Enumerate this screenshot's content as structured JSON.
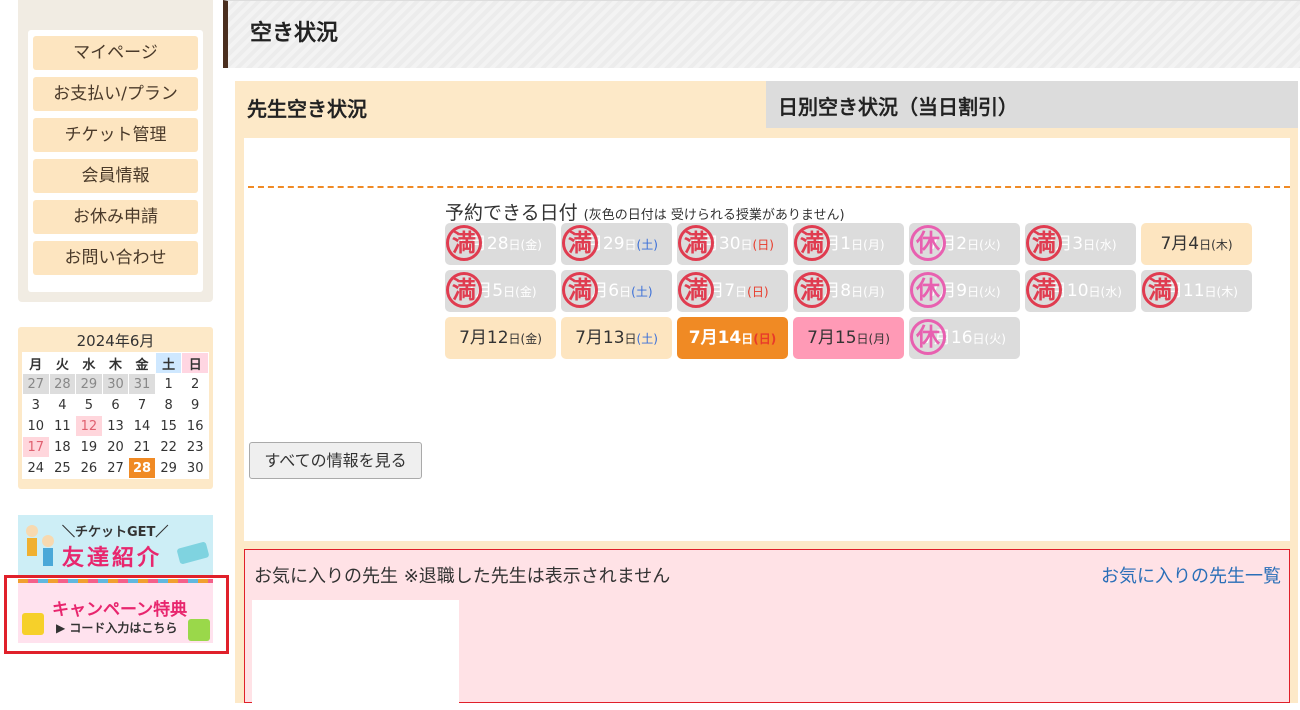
{
  "sidebar": {
    "menu": [
      "マイページ",
      "お支払い/プラン",
      "チケット管理",
      "会員情報",
      "お休み申請",
      "お問い合わせ"
    ]
  },
  "calendar": {
    "title": "2024年6月",
    "weekdays": [
      "月",
      "火",
      "水",
      "木",
      "金",
      "土",
      "日"
    ],
    "weeks": [
      [
        "27",
        "28",
        "29",
        "30",
        "31",
        "1",
        "2"
      ],
      [
        "3",
        "4",
        "5",
        "6",
        "7",
        "8",
        "9"
      ],
      [
        "10",
        "11",
        "12",
        "13",
        "14",
        "15",
        "16"
      ],
      [
        "17",
        "18",
        "19",
        "20",
        "21",
        "22",
        "23"
      ],
      [
        "24",
        "25",
        "26",
        "27",
        "28",
        "29",
        "30"
      ]
    ],
    "today": "28"
  },
  "banners": {
    "friend_small": "＼チケットGET／",
    "friend_big": "友達紹介",
    "campaign_big": "キャンペーン特典",
    "campaign_small": "▶ コード入力はこちら"
  },
  "header": {
    "title": "空き状況"
  },
  "tabs": {
    "active": "先生空き状況",
    "inactive": "日別空き状況（当日割引）"
  },
  "availability": {
    "title": "予約できる日付",
    "note": "(灰色の日付は 受けられる授業がありません)",
    "dates": [
      {
        "md": "6月",
        "day": "28",
        "dow": "金",
        "state": "full",
        "mark": "満"
      },
      {
        "md": "6月",
        "day": "29",
        "dow": "土",
        "state": "full",
        "mark": "満"
      },
      {
        "md": "6月",
        "day": "30",
        "dow": "日",
        "state": "full",
        "mark": "満"
      },
      {
        "md": "7月",
        "day": "1",
        "dow": "月",
        "state": "full",
        "mark": "満"
      },
      {
        "md": "7月",
        "day": "2",
        "dow": "火",
        "state": "full",
        "mark": "休"
      },
      {
        "md": "7月",
        "day": "3",
        "dow": "水",
        "state": "full",
        "mark": "満"
      },
      {
        "md": "7月",
        "day": "4",
        "dow": "木",
        "state": "ok",
        "mark": ""
      },
      {
        "md": "7月",
        "day": "5",
        "dow": "金",
        "state": "full",
        "mark": "満"
      },
      {
        "md": "7月",
        "day": "6",
        "dow": "土",
        "state": "full",
        "mark": "満"
      },
      {
        "md": "7月",
        "day": "7",
        "dow": "日",
        "state": "full",
        "mark": "満"
      },
      {
        "md": "7月",
        "day": "8",
        "dow": "月",
        "state": "full",
        "mark": "満"
      },
      {
        "md": "7月",
        "day": "9",
        "dow": "火",
        "state": "full",
        "mark": "休"
      },
      {
        "md": "7月",
        "day": "10",
        "dow": "水",
        "state": "full",
        "mark": "満"
      },
      {
        "md": "7月",
        "day": "11",
        "dow": "木",
        "state": "full",
        "mark": "満"
      },
      {
        "md": "7月",
        "day": "12",
        "dow": "金",
        "state": "ok",
        "mark": ""
      },
      {
        "md": "7月",
        "day": "13",
        "dow": "土",
        "state": "ok",
        "mark": ""
      },
      {
        "md": "7月",
        "day": "14",
        "dow": "日",
        "state": "sel",
        "mark": ""
      },
      {
        "md": "7月",
        "day": "15",
        "dow": "月",
        "state": "pink",
        "mark": ""
      },
      {
        "md": "7月",
        "day": "16",
        "dow": "火",
        "state": "full",
        "mark": "休"
      }
    ],
    "day_suffix": "日",
    "all_button": "すべての情報を見る"
  },
  "favorites": {
    "title": "お気に入りの先生 ※退職した先生は表示されません",
    "link": "お気に入りの先生一覧"
  }
}
